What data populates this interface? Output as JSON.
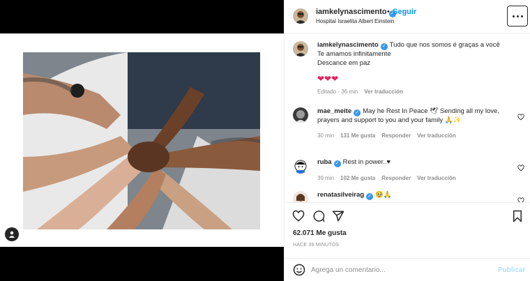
{
  "post": {
    "username": "iamkelynascimento",
    "follow_label": "Seguir",
    "separator": "•",
    "location": "Hospital Israelita Albert Einstein"
  },
  "caption": {
    "username": "iamkelynascimento",
    "line1": "Tudo que nos somos é graças a você",
    "line2": "Te amamos infinitamente",
    "line3": "Descance em paz",
    "hearts": "❤❤❤",
    "edited": "Editado · 36 min",
    "see_translation": "Ver traducción"
  },
  "comments": [
    {
      "username": "mae_meite",
      "text": "May he Rest In Peace 🕊 Sending all my love, prayers and support to you and your family 🙏✨",
      "time": "30 min",
      "likes": "131 Me gusta",
      "reply": "Responder",
      "translate": "Ver traducción"
    },
    {
      "username": "ruba",
      "text": "Rest in power..♥",
      "time": "39 min",
      "likes": "102 Me gusta",
      "reply": "Responder",
      "translate": "Ver traducción"
    },
    {
      "username": "renatasilveirag",
      "text": "🥹🙏"
    }
  ],
  "stats": {
    "likes": "62.071 Me gusta",
    "when": "HACE 39 MINUTOS"
  },
  "composer": {
    "placeholder": "Agrega un comentario...",
    "post_label": "Publicar"
  },
  "icons": {
    "more": "more-options-icon",
    "verified": "verified-badge-icon",
    "like": "heart-icon",
    "comment": "comment-icon",
    "share": "send-icon",
    "save": "bookmark-icon",
    "emoji": "emoji-icon",
    "user_tag": "user-tag-icon"
  },
  "colors": {
    "accent": "#0095f6",
    "verified": "#3897f0",
    "heart": "#e0245e",
    "muted": "#8e8e8e"
  }
}
